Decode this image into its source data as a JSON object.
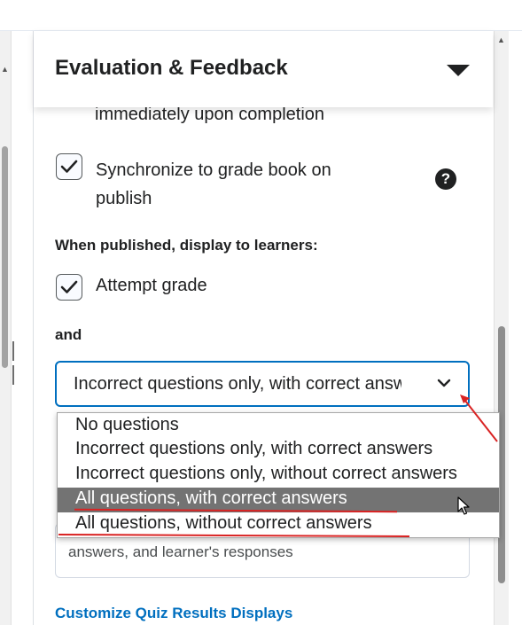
{
  "panel": {
    "title": "Evaluation & Feedback"
  },
  "partial_text": "immediately upon completion",
  "sync": {
    "label": "Synchronize to grade book on publish",
    "checked": true
  },
  "display_heading": "When published, display to learners:",
  "attempt_grade": {
    "label": "Attempt grade",
    "checked": true
  },
  "and_label": "and",
  "select": {
    "value": "Incorrect questions only, with correct answers"
  },
  "dropdown": {
    "options": [
      "No questions",
      "Incorrect questions only, with correct answers",
      "Incorrect questions only, without correct answers",
      "All questions, with correct answers",
      "All questions, without correct answers"
    ],
    "highlighted_index": 3
  },
  "behind_text": "answers, and learner's responses",
  "customize_link": "Customize Quiz Results Displays",
  "colors": {
    "accent": "#006fbf",
    "highlight": "#737373",
    "annotation": "#d92323"
  }
}
